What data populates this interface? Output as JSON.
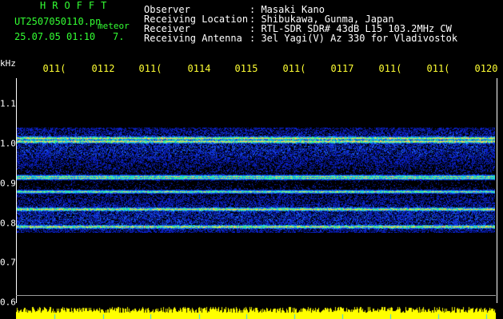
{
  "header": {
    "app_title": "HROFFT",
    "file_name": "UT2507050110.pn",
    "mode": "meteor",
    "date_time": "25.07.05 01:10",
    "count": "7."
  },
  "info": [
    {
      "label": "Observer",
      "value": ": Masaki Kano"
    },
    {
      "label": "Receiving Location",
      "value": ": Shibukawa, Gunma, Japan"
    },
    {
      "label": "Receiver",
      "value": ": RTL-SDR SDR# 43dB L15 103.2MHz CW"
    },
    {
      "label": "Receiving Antenna",
      "value": ": 3el Yagi(V) Az 330 for Vladivostok"
    }
  ],
  "axis": {
    "unit": "kHz",
    "time_ticks": [
      "011(",
      "0112",
      "011(",
      "0114",
      "0115",
      "011(",
      "0117",
      "011(",
      "011(",
      "0120"
    ],
    "freq_ticks": [
      "1.1",
      "1.0",
      "0.9",
      "0.8",
      "0.7",
      "0.6"
    ]
  },
  "colors": {
    "header_green": "#33ff33",
    "text_white": "#ffffff",
    "tick_yellow": "#ffff33",
    "noise_blue": "#0a1fbf",
    "amplitude_yellow": "#ffff00"
  }
}
